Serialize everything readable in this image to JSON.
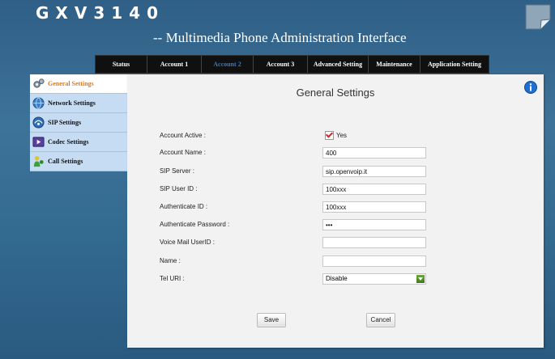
{
  "header": {
    "brand": "GXV3140",
    "subtitle": "-- Multimedia Phone Administration Interface"
  },
  "nav": {
    "tabs": [
      {
        "label": "Status",
        "active": false
      },
      {
        "label": "Account 1",
        "active": false
      },
      {
        "label": "Account 2",
        "active": true
      },
      {
        "label": "Account 3",
        "active": false
      },
      {
        "label": "Advanced Setting",
        "active": false
      },
      {
        "label": "Maintenance",
        "active": false
      },
      {
        "label": "Application Setting",
        "active": false
      }
    ]
  },
  "sidebar": {
    "items": [
      {
        "label": "General Settings",
        "icon": "gear-icon",
        "active": true
      },
      {
        "label": "Network Settings",
        "icon": "globe-icon",
        "active": false
      },
      {
        "label": "SIP Settings",
        "icon": "network-icon",
        "active": false
      },
      {
        "label": "Codec Settings",
        "icon": "media-icon",
        "active": false
      },
      {
        "label": "Call Settings",
        "icon": "phone-icon",
        "active": false
      }
    ]
  },
  "panel": {
    "title": "General Settings",
    "account_active": {
      "label": "Account Active :",
      "checked": true,
      "option_label": "Yes"
    },
    "fields": [
      {
        "label": "Account Name :",
        "value": "400"
      },
      {
        "label": "SIP Server :",
        "value": "sip.openvoip.it"
      },
      {
        "label": "SIP User ID :",
        "value": "100xxx"
      },
      {
        "label": "Authenticate ID :",
        "value": "100xxx"
      },
      {
        "label": "Authenticate Password :",
        "value": "•••"
      },
      {
        "label": "Voice Mail UserID :",
        "value": ""
      },
      {
        "label": "Name :",
        "value": ""
      }
    ],
    "tel_uri": {
      "label": "Tel URI :",
      "selected": "Disable"
    },
    "save_label": "Save",
    "cancel_label": "Cancel"
  },
  "colors": {
    "active_tab": "#3a78c2",
    "active_sidebar": "#e0791c",
    "sidebar_bg": "#c6dcf3"
  }
}
